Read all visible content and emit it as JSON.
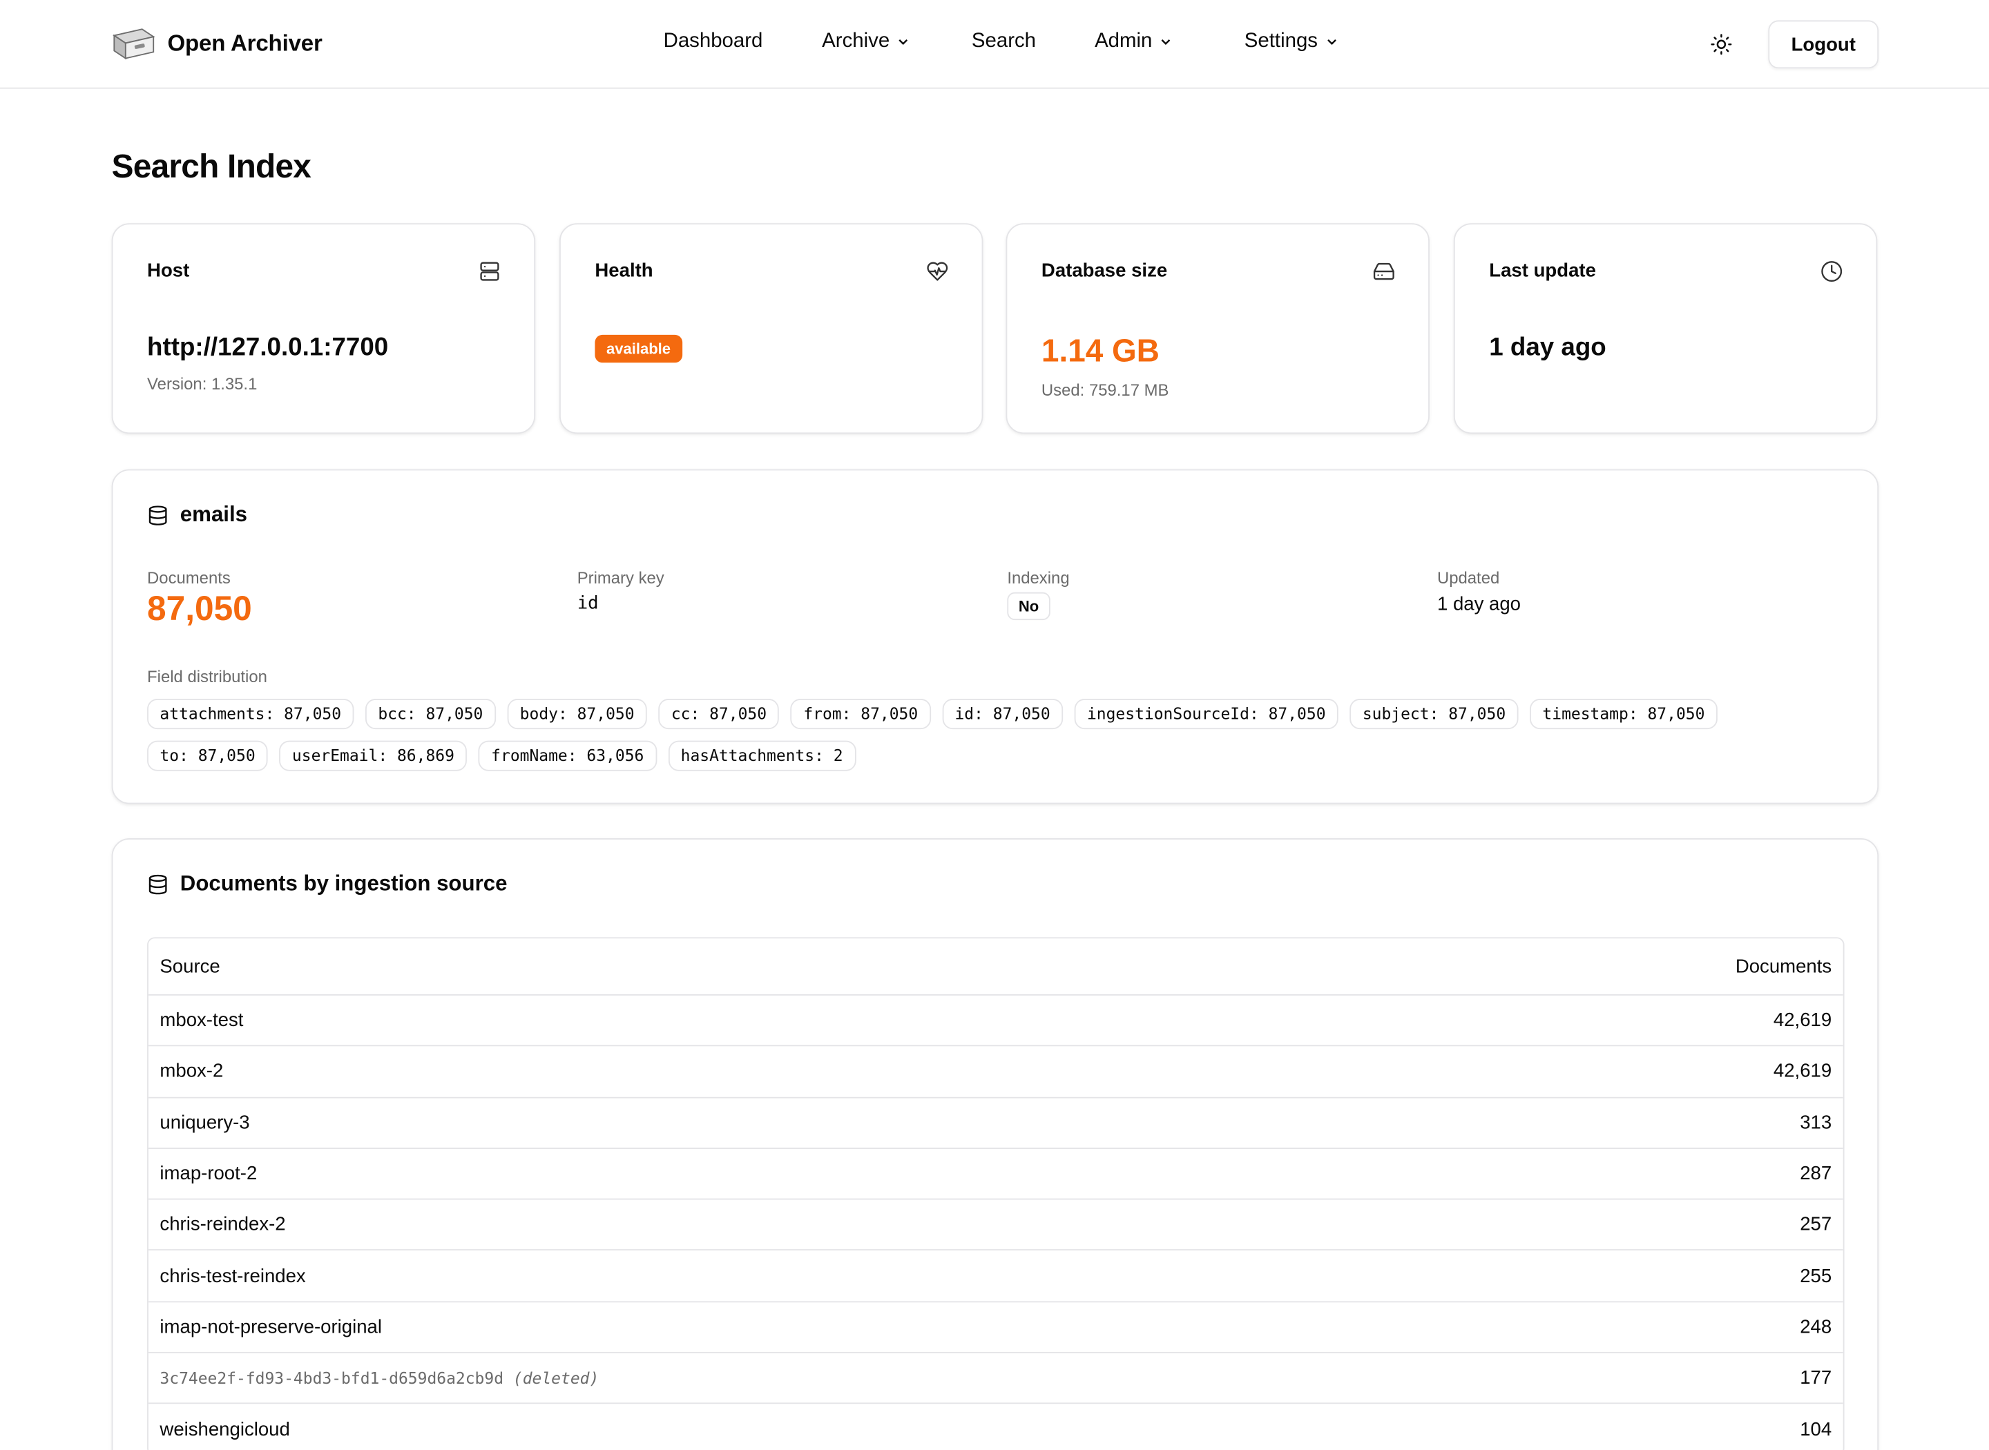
{
  "app": {
    "name": "Open Archiver"
  },
  "nav": {
    "items": [
      {
        "label": "Dashboard",
        "dropdown": false
      },
      {
        "label": "Archive",
        "dropdown": true
      },
      {
        "label": "Search",
        "dropdown": false
      },
      {
        "label": "Admin",
        "dropdown": true
      },
      {
        "label": "Settings",
        "dropdown": true
      }
    ],
    "logout_label": "Logout",
    "theme_icon": "sun-icon"
  },
  "page": {
    "title": "Search Index"
  },
  "stats": {
    "host": {
      "label": "Host",
      "value": "http://127.0.0.1:7700",
      "sub": "Version: 1.35.1",
      "icon": "server-icon"
    },
    "health": {
      "label": "Health",
      "badge": "available",
      "icon": "heart-pulse-icon"
    },
    "dbsize": {
      "label": "Database size",
      "value": "1.14 GB",
      "sub": "Used: 759.17 MB",
      "icon": "hard-drive-icon"
    },
    "lastupdate": {
      "label": "Last update",
      "value": "1 day ago",
      "icon": "clock-icon"
    }
  },
  "index": {
    "name": "emails",
    "documents_label": "Documents",
    "documents": "87,050",
    "primary_key_label": "Primary key",
    "primary_key": "id",
    "indexing_label": "Indexing",
    "indexing": "No",
    "updated_label": "Updated",
    "updated": "1 day ago",
    "field_distribution_label": "Field distribution",
    "fields": [
      "attachments: 87,050",
      "bcc: 87,050",
      "body: 87,050",
      "cc: 87,050",
      "from: 87,050",
      "id: 87,050",
      "ingestionSourceId: 87,050",
      "subject: 87,050",
      "timestamp: 87,050",
      "to: 87,050",
      "userEmail: 86,869",
      "fromName: 63,056",
      "hasAttachments: 2"
    ]
  },
  "ingestion": {
    "title": "Documents by ingestion source",
    "columns": {
      "source": "Source",
      "documents": "Documents"
    },
    "rows": [
      {
        "source": "mbox-test",
        "documents": "42,619"
      },
      {
        "source": "mbox-2",
        "documents": "42,619"
      },
      {
        "source": "uniquery-3",
        "documents": "313"
      },
      {
        "source": "imap-root-2",
        "documents": "287"
      },
      {
        "source": "chris-reindex-2",
        "documents": "257"
      },
      {
        "source": "chris-test-reindex",
        "documents": "255"
      },
      {
        "source": "imap-not-preserve-original",
        "documents": "248"
      },
      {
        "source": "3c74ee2f-fd93-4bd3-bfd1-d659d6a2cb9d",
        "deleted_tag": "(deleted)",
        "documents": "177"
      },
      {
        "source": "weishengicloud",
        "documents": "104"
      }
    ]
  },
  "colors": {
    "accent": "#f46a0f",
    "border": "#e4e4e7",
    "muted": "#6b6b6b"
  }
}
